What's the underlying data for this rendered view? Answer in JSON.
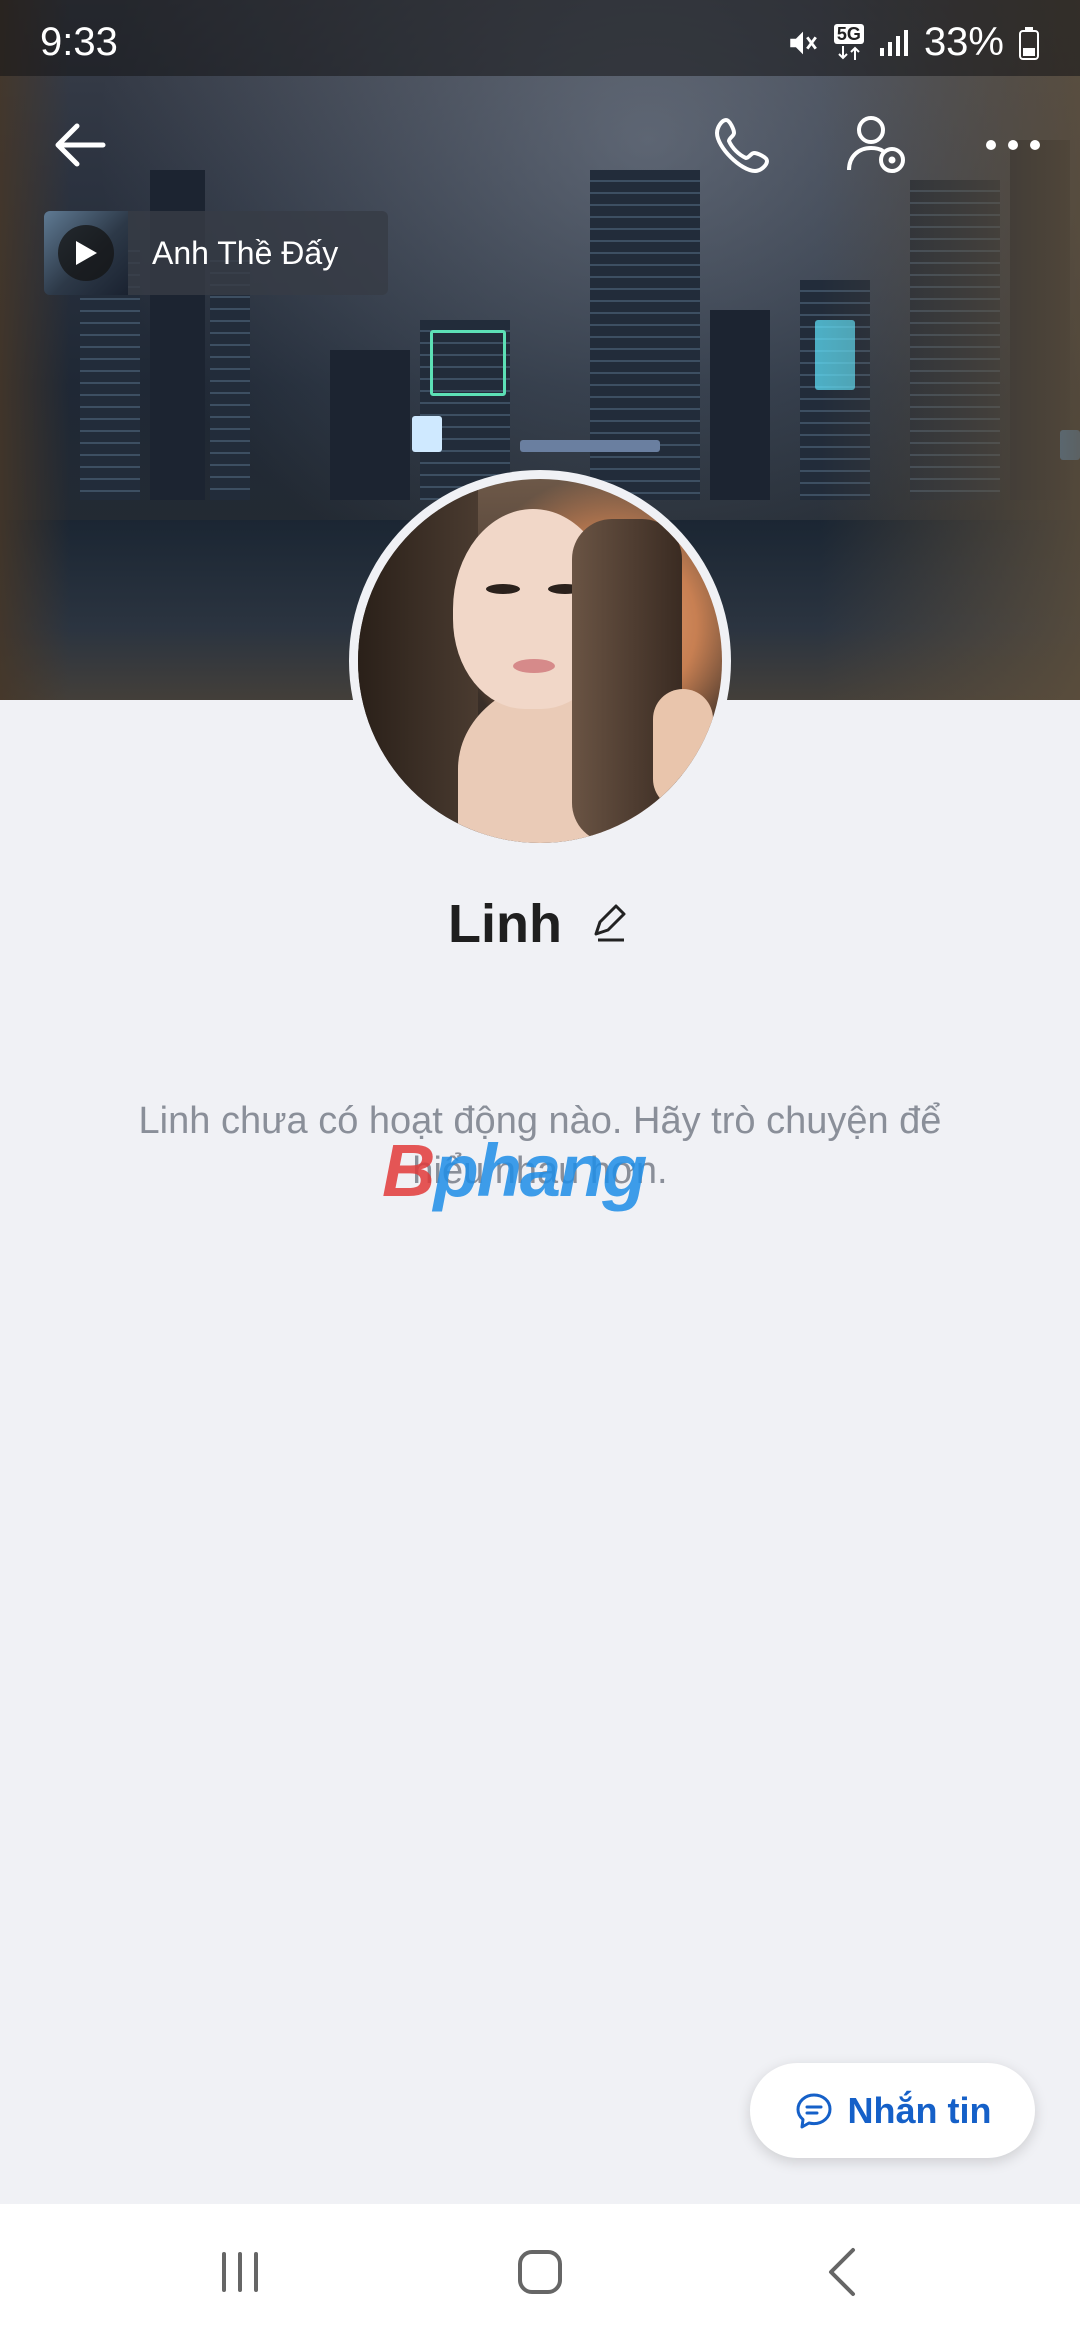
{
  "status_bar": {
    "time": "9:33",
    "network": "5G",
    "battery": "33%",
    "icons": [
      "mute-icon",
      "network-5g-icon",
      "signal-icon",
      "battery-icon"
    ]
  },
  "header": {
    "icons": [
      "back-arrow-icon",
      "phone-icon",
      "user-settings-icon",
      "more-icon"
    ]
  },
  "music": {
    "title": "Anh Thề Đấy",
    "icon": "play-icon"
  },
  "profile": {
    "name": "Linh",
    "edit_icon": "pencil-icon"
  },
  "activity": {
    "empty_message": "Linh chưa có hoạt động nào. Hãy trò chuyện để hiểu nhau hơn."
  },
  "watermark": {
    "first": "B",
    "rest": "phang"
  },
  "message_button": {
    "label": "Nhắn tin",
    "icon": "chat-bubble-icon"
  },
  "nav": {
    "icons": [
      "recent-apps-icon",
      "home-icon",
      "back-icon"
    ]
  },
  "colors": {
    "accent": "#1560c8",
    "background": "#f0f1f5"
  }
}
